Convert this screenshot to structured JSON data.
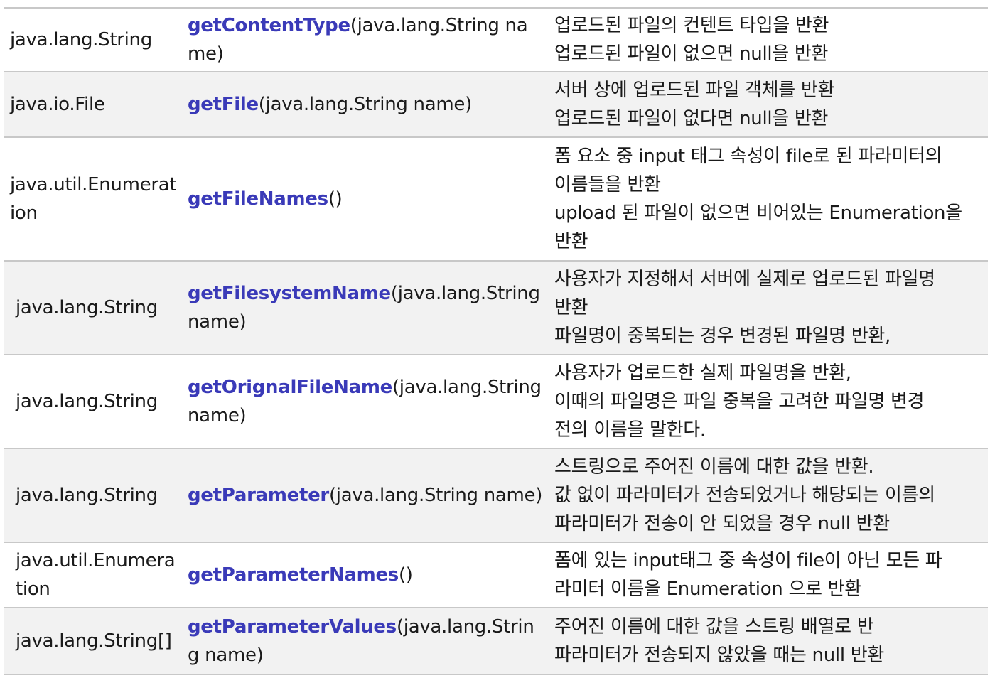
{
  "rows": [
    {
      "type": "java.lang.String",
      "method": "getContentType",
      "params": "(java.lang.String name)",
      "desc": [
        "업로드된 파일의 컨텐트 타입을 반환",
        "업로드된 파일이 없으면 null을 반환"
      ]
    },
    {
      "type": "java.io.File",
      "method": "getFile",
      "params": "(java.lang.String name)",
      "desc": [
        "서버 상에 업로드된 파일 객체를 반환",
        "업로드된 파일이 없다면 null을 반환"
      ]
    },
    {
      "type": "java.util.Enumeration",
      "method": "getFileNames",
      "params": "()",
      "desc": [
        "폼 요소 중 input 태그 속성이 file로 된 파라미터의",
        "이름들을 반환",
        "upload 된 파일이 없으면 비어있는 Enumeration을",
        "반환"
      ]
    },
    {
      "type": "java.lang.String",
      "method": "getFilesystemName",
      "params": "(java.lang.String name)",
      "desc": [
        "사용자가 지정해서 서버에 실제로 업로드된 파일명",
        "반환",
        "파일명이 중복되는 경우 변경된 파일명 반환,"
      ]
    },
    {
      "type": "java.lang.String",
      "method": "getOrignalFileName",
      "params": "(java.lang.String name)",
      "desc": [
        "사용자가 업로드한 실제 파일명을 반환,",
        "이때의 파일명은 파일 중복을 고려한 파일명 변경",
        "전의 이름을 말한다."
      ]
    },
    {
      "type": "java.lang.String",
      "method": "getParameter",
      "params": "(java.lang.String name)",
      "desc": [
        "스트링으로 주어진 이름에 대한 값을 반환.",
        "값 없이 파라미터가 전송되었거나 해당되는 이름의",
        "파라미터가 전송이 안 되었을 경우 null 반환"
      ]
    },
    {
      "type": "java.util.Enumeration",
      "method": "getParameterNames",
      "params": "()",
      "desc": [
        "폼에 있는 input태그 중 속성이 file이 아닌 모든 파",
        "라미터 이름을 Enumeration 으로 반환"
      ]
    },
    {
      "type": "java.lang.String[]",
      "method": "getParameterValues",
      "params": "(java.lang.String name)",
      "desc": [
        "주어진 이름에 대한 값을 스트링 배열로 반",
        "파라미터가 전송되지 않았을 때는 null 반환"
      ]
    }
  ],
  "colors": {
    "method_name": "#3a3ab8",
    "alt_row_bg": "#f2f2f2",
    "border": "#c8c8c8"
  }
}
